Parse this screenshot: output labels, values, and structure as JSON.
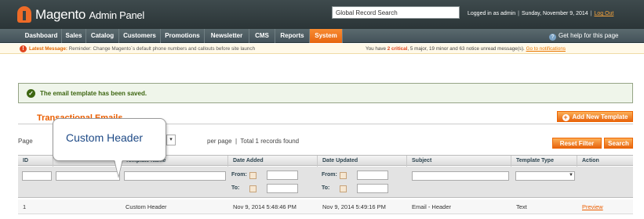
{
  "header": {
    "logo_text": "Magento",
    "logo_sub": "Admin Panel",
    "search_value": "Global Record Search",
    "logged_in": "Logged in as admin",
    "date": "Sunday, November 9, 2014",
    "logout": "Log Out"
  },
  "nav": {
    "items": [
      {
        "label": "Dashboard"
      },
      {
        "label": "Sales"
      },
      {
        "label": "Catalog"
      },
      {
        "label": "Customers"
      },
      {
        "label": "Promotions"
      },
      {
        "label": "Newsletter"
      },
      {
        "label": "CMS"
      },
      {
        "label": "Reports"
      },
      {
        "label": "System"
      }
    ],
    "active": "System",
    "help": "Get help for this page"
  },
  "notice": {
    "label": "Latest Message:",
    "text": "Reminder: Change Magento`s default phone numbers and callouts before site launch",
    "right_prefix": "You have",
    "critical": "2 critical",
    "rest": ", 5 major, 19 minor and 63 notice unread message(s).",
    "link": "Go to notifications"
  },
  "success_message": "The email template has been saved.",
  "page_title": "Transactional Emails",
  "buttons": {
    "add_new": "Add New Template",
    "reset_filter": "Reset Filter",
    "search": "Search"
  },
  "pager": {
    "page_label": "Page",
    "per_page": "per page",
    "records": "Total 1 records found"
  },
  "grid": {
    "columns": [
      "ID",
      "",
      "Template Name",
      "Date Added",
      "Date Updated",
      "Subject",
      "Template Type",
      "Action"
    ],
    "filter_from": "From:",
    "filter_to": "To:",
    "rows": [
      {
        "id": "1",
        "name": "Custom Header",
        "added": "Nov 9, 2014 5:48:46 PM",
        "updated": "Nov 9, 2014 5:49:16 PM",
        "subject": "Email - Header",
        "type": "Text",
        "action": "Preview"
      }
    ]
  },
  "callout": {
    "text": "Custom Header"
  }
}
